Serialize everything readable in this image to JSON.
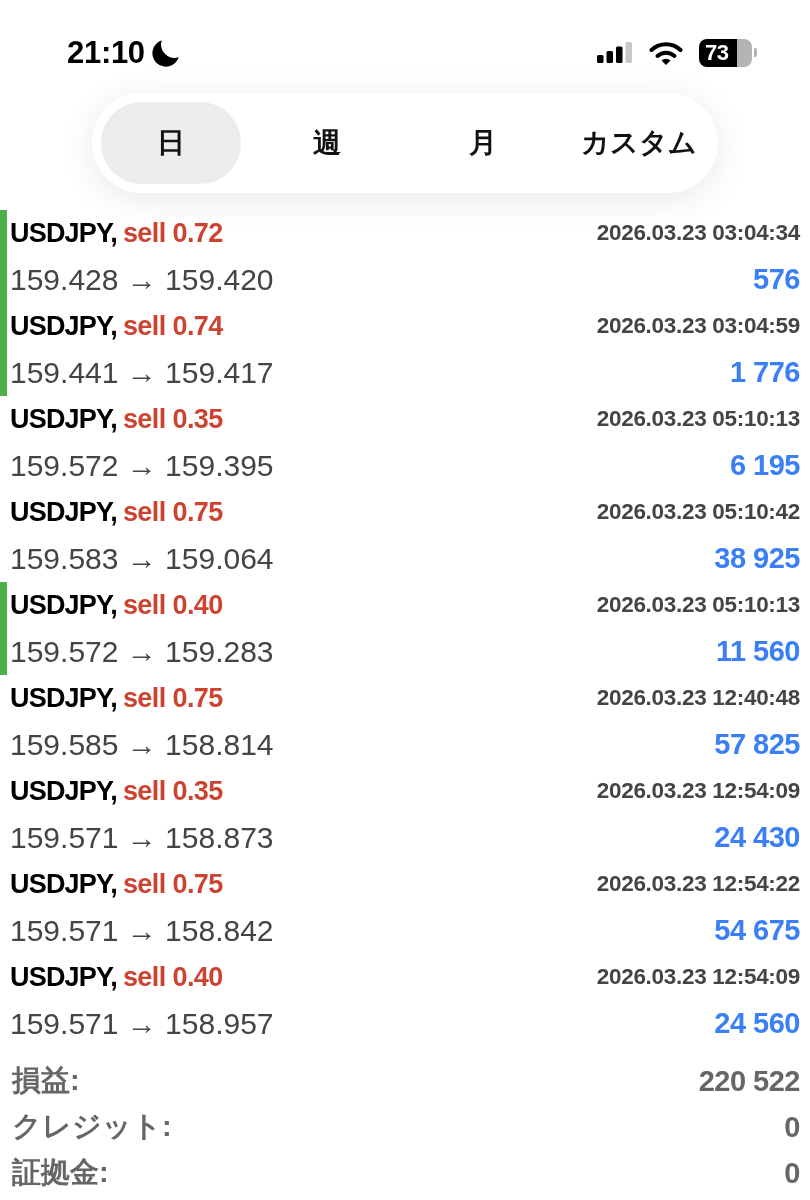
{
  "status_bar": {
    "time": "21:10",
    "battery": "73"
  },
  "tabs": [
    {
      "label": "日",
      "selected": true
    },
    {
      "label": "週",
      "selected": false
    },
    {
      "label": "月",
      "selected": false
    },
    {
      "label": "カスタム",
      "selected": false
    }
  ],
  "trades": [
    {
      "symbol": "USDJPY,",
      "side": "sell 0.72",
      "time": "2026.03.23 03:04:34",
      "prices": "159.428 → 159.420",
      "profit": "576",
      "marked": true
    },
    {
      "symbol": "USDJPY,",
      "side": "sell 0.74",
      "time": "2026.03.23 03:04:59",
      "prices": "159.441 → 159.417",
      "profit": "1 776",
      "marked": true
    },
    {
      "symbol": "USDJPY,",
      "side": "sell 0.35",
      "time": "2026.03.23 05:10:13",
      "prices": "159.572 → 159.395",
      "profit": "6 195",
      "marked": false
    },
    {
      "symbol": "USDJPY,",
      "side": "sell 0.75",
      "time": "2026.03.23 05:10:42",
      "prices": "159.583 → 159.064",
      "profit": "38 925",
      "marked": false
    },
    {
      "symbol": "USDJPY,",
      "side": "sell 0.40",
      "time": "2026.03.23 05:10:13",
      "prices": "159.572 → 159.283",
      "profit": "11 560",
      "marked": true
    },
    {
      "symbol": "USDJPY,",
      "side": "sell 0.75",
      "time": "2026.03.23 12:40:48",
      "prices": "159.585 → 158.814",
      "profit": "57 825",
      "marked": false
    },
    {
      "symbol": "USDJPY,",
      "side": "sell 0.35",
      "time": "2026.03.23 12:54:09",
      "prices": "159.571 → 158.873",
      "profit": "24 430",
      "marked": false
    },
    {
      "symbol": "USDJPY,",
      "side": "sell 0.75",
      "time": "2026.03.23 12:54:22",
      "prices": "159.571 → 158.842",
      "profit": "54 675",
      "marked": false
    },
    {
      "symbol": "USDJPY,",
      "side": "sell 0.40",
      "time": "2026.03.23 12:54:09",
      "prices": "159.571 → 158.957",
      "profit": "24 560",
      "marked": false
    }
  ],
  "summary": [
    {
      "label": "損益:",
      "value": "220 522"
    },
    {
      "label": "クレジット:",
      "value": "0"
    },
    {
      "label": "証拠金:",
      "value": "0"
    }
  ]
}
